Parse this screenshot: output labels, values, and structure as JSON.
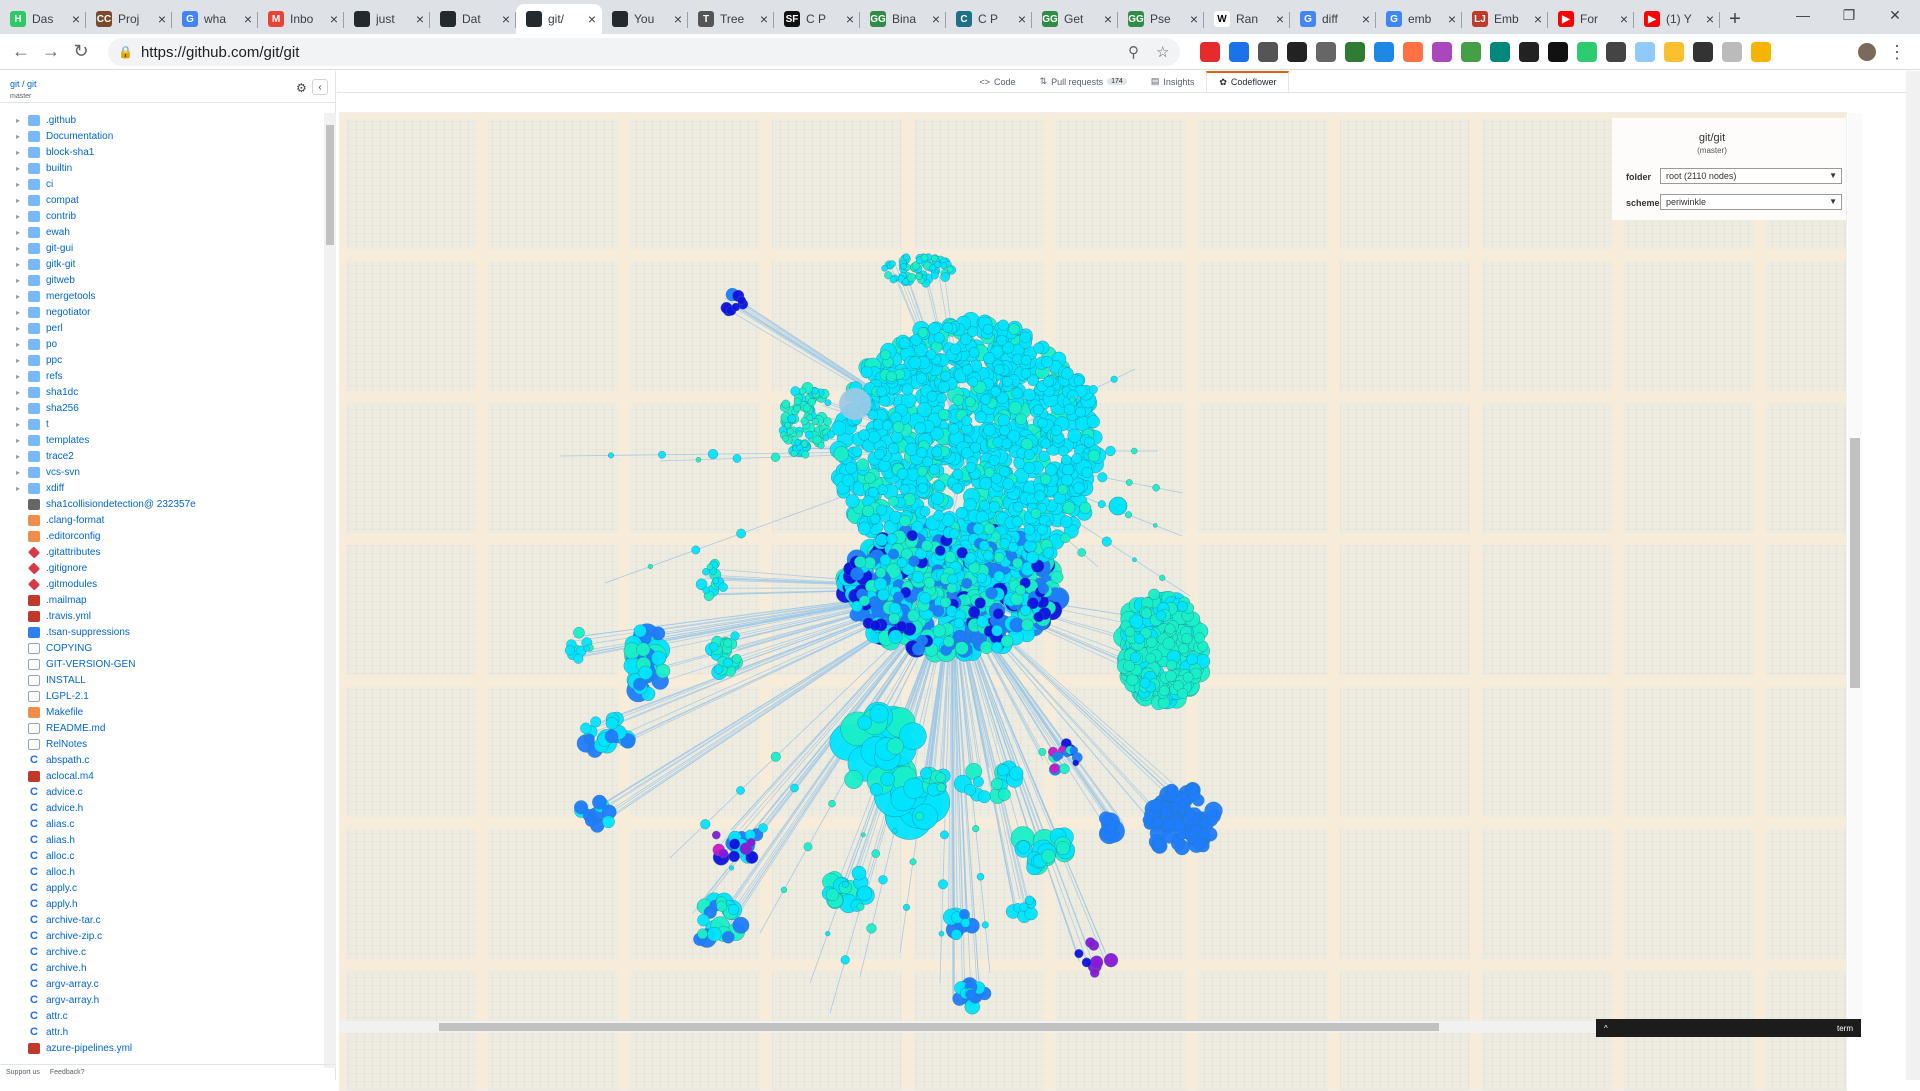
{
  "tabs": [
    {
      "title": "Das",
      "icon": "hackerrank-icon",
      "color": "#2ec866",
      "letter": "H"
    },
    {
      "title": "Proj",
      "icon": "codecademy-icon",
      "color": "#7a4a2a",
      "letter": "CC"
    },
    {
      "title": "wha",
      "icon": "google-icon",
      "color": "#4285f4",
      "letter": "G"
    },
    {
      "title": "Inbo",
      "icon": "gmail-icon",
      "color": "#ea4335",
      "letter": "M"
    },
    {
      "title": "just",
      "icon": "github-icon",
      "color": "#24292e",
      "letter": ""
    },
    {
      "title": "Dat",
      "icon": "github-icon",
      "color": "#24292e",
      "letter": ""
    },
    {
      "title": "git/",
      "icon": "github-icon",
      "color": "#24292e",
      "letter": "",
      "active": true
    },
    {
      "title": "You",
      "icon": "github-icon",
      "color": "#24292e",
      "letter": ""
    },
    {
      "title": "Tree",
      "icon": "tree-icon",
      "color": "#555555",
      "letter": "T"
    },
    {
      "title": "C P",
      "icon": "sourceforge-icon",
      "color": "#111111",
      "letter": "SF"
    },
    {
      "title": "Bina",
      "icon": "geeksforgeeks-icon",
      "color": "#2f8d46",
      "letter": "GG"
    },
    {
      "title": "C P",
      "icon": "c-icon",
      "color": "#1e6f87",
      "letter": "C"
    },
    {
      "title": "Get",
      "icon": "geeksforgeeks-icon",
      "color": "#2f8d46",
      "letter": "GG"
    },
    {
      "title": "Pse",
      "icon": "geeksforgeeks-icon",
      "color": "#2f8d46",
      "letter": "GG"
    },
    {
      "title": "Ran",
      "icon": "wikipedia-icon",
      "color": "#ffffff",
      "letter": "W"
    },
    {
      "title": "diff",
      "icon": "google-icon",
      "color": "#4285f4",
      "letter": "G"
    },
    {
      "title": "emb",
      "icon": "google-icon",
      "color": "#4285f4",
      "letter": "G"
    },
    {
      "title": "Emb",
      "icon": "lj-icon",
      "color": "#c0392b",
      "letter": "LJ"
    },
    {
      "title": "For",
      "icon": "youtube-icon",
      "color": "#ff0000",
      "letter": "▶"
    },
    {
      "title": "(1) Y",
      "icon": "youtube-icon",
      "color": "#ff0000",
      "letter": "▶"
    }
  ],
  "address": {
    "url": "https://github.com/git/git"
  },
  "extensions": [
    "#e52b2b",
    "#1a73e8",
    "#555555",
    "#222222",
    "#666666",
    "#2e7d32",
    "#1e88e5",
    "#ff7043",
    "#ab47bc",
    "#43a047",
    "#00897b",
    "#222222",
    "#111111",
    "#2ecc71",
    "#444444",
    "#90caf9",
    "#fbc02d",
    "#333333",
    "#bbbbbb",
    "#f4b400"
  ],
  "sidebar": {
    "repo": "git / git",
    "branch": "master",
    "items": [
      {
        "name": ".github",
        "type": "folder"
      },
      {
        "name": "Documentation",
        "type": "folder"
      },
      {
        "name": "block-sha1",
        "type": "folder"
      },
      {
        "name": "builtin",
        "type": "folder"
      },
      {
        "name": "ci",
        "type": "folder"
      },
      {
        "name": "compat",
        "type": "folder"
      },
      {
        "name": "contrib",
        "type": "folder"
      },
      {
        "name": "ewah",
        "type": "folder"
      },
      {
        "name": "git-gui",
        "type": "folder"
      },
      {
        "name": "gitk-git",
        "type": "folder"
      },
      {
        "name": "gitweb",
        "type": "folder"
      },
      {
        "name": "mergetools",
        "type": "folder"
      },
      {
        "name": "negotiator",
        "type": "folder"
      },
      {
        "name": "perl",
        "type": "folder"
      },
      {
        "name": "po",
        "type": "folder"
      },
      {
        "name": "ppc",
        "type": "folder"
      },
      {
        "name": "refs",
        "type": "folder"
      },
      {
        "name": "sha1dc",
        "type": "folder"
      },
      {
        "name": "sha256",
        "type": "folder"
      },
      {
        "name": "t",
        "type": "folder"
      },
      {
        "name": "templates",
        "type": "folder"
      },
      {
        "name": "trace2",
        "type": "folder"
      },
      {
        "name": "vcs-svn",
        "type": "folder"
      },
      {
        "name": "xdiff",
        "type": "folder"
      },
      {
        "name": "sha1collisiondetection@ 232357e",
        "type": "sub"
      },
      {
        "name": ".clang-format",
        "type": "orange"
      },
      {
        "name": ".editorconfig",
        "type": "orange"
      },
      {
        "name": ".gitattributes",
        "type": "git"
      },
      {
        "name": ".gitignore",
        "type": "git"
      },
      {
        "name": ".gitmodules",
        "type": "git"
      },
      {
        "name": ".mailmap",
        "type": "red"
      },
      {
        "name": ".travis.yml",
        "type": "red"
      },
      {
        "name": ".tsan-suppressions",
        "type": "blue"
      },
      {
        "name": "COPYING",
        "type": "file"
      },
      {
        "name": "GIT-VERSION-GEN",
        "type": "file"
      },
      {
        "name": "INSTALL",
        "type": "file"
      },
      {
        "name": "LGPL-2.1",
        "type": "file"
      },
      {
        "name": "Makefile",
        "type": "orange"
      },
      {
        "name": "README.md",
        "type": "file"
      },
      {
        "name": "RelNotes",
        "type": "file"
      },
      {
        "name": "abspath.c",
        "type": "c"
      },
      {
        "name": "aclocal.m4",
        "type": "red"
      },
      {
        "name": "advice.c",
        "type": "c"
      },
      {
        "name": "advice.h",
        "type": "c"
      },
      {
        "name": "alias.c",
        "type": "c"
      },
      {
        "name": "alias.h",
        "type": "c"
      },
      {
        "name": "alloc.c",
        "type": "c"
      },
      {
        "name": "alloc.h",
        "type": "c"
      },
      {
        "name": "apply.c",
        "type": "c"
      },
      {
        "name": "apply.h",
        "type": "c"
      },
      {
        "name": "archive-tar.c",
        "type": "c"
      },
      {
        "name": "archive-zip.c",
        "type": "c"
      },
      {
        "name": "archive.c",
        "type": "c"
      },
      {
        "name": "archive.h",
        "type": "c"
      },
      {
        "name": "argv-array.c",
        "type": "c"
      },
      {
        "name": "argv-array.h",
        "type": "c"
      },
      {
        "name": "attr.c",
        "type": "c"
      },
      {
        "name": "attr.h",
        "type": "c"
      },
      {
        "name": "azure-pipelines.yml",
        "type": "red"
      }
    ],
    "footer": {
      "support": "Support us",
      "feedback": "Feedback?"
    }
  },
  "repo_tabs": {
    "code": "Code",
    "pull_requests": "Pull requests",
    "pull_count": "174",
    "insights": "Insights",
    "codeflower": "Codeflower"
  },
  "codeflower": {
    "title": "git/git",
    "subtitle": "(master)",
    "folder_label": "folder",
    "folder_value": "root (2110 nodes)",
    "scheme_label": "scheme",
    "scheme_value": "periwinkle",
    "colors": {
      "cyan": "#00e5ff",
      "teal": "#19f0c8",
      "blue": "#1f7cff",
      "royal": "#1010e0",
      "purple": "#8a18d8",
      "magenta": "#d514c8",
      "link": "#9ec8e6"
    }
  },
  "term": {
    "label": "term",
    "caret": "^"
  }
}
